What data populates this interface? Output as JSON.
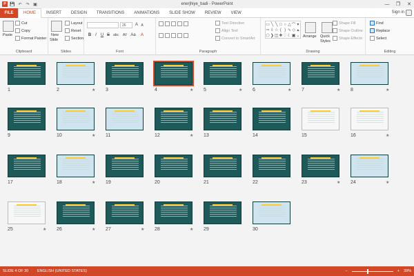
{
  "window": {
    "title": "enerjhiye_badi - PowerPoint",
    "signin": "Sign in",
    "minimize": "—",
    "restore": "❐",
    "close": "✕"
  },
  "qat": {
    "save": "💾",
    "undo": "↶",
    "redo": "↷",
    "start": "▣"
  },
  "tabs": [
    {
      "label": "FILE"
    },
    {
      "label": "HOME"
    },
    {
      "label": "INSERT"
    },
    {
      "label": "DESIGN"
    },
    {
      "label": "TRANSITIONS"
    },
    {
      "label": "ANIMATIONS"
    },
    {
      "label": "SLIDE SHOW"
    },
    {
      "label": "REVIEW"
    },
    {
      "label": "VIEW"
    }
  ],
  "ribbon": {
    "clipboard": {
      "label": "Clipboard",
      "paste": "Paste",
      "cut": "Cut",
      "copy": "Copy",
      "format_painter": "Format Painter"
    },
    "slides": {
      "label": "Slides",
      "new_slide": "New",
      "new_slide2": "Slide",
      "layout": "Layout",
      "reset": "Reset",
      "section": "Section"
    },
    "font": {
      "label": "Font",
      "size": "26",
      "bold": "B",
      "italic": "I",
      "underline": "U",
      "strike": "S",
      "shadow": "abc",
      "spacing": "AV",
      "case": "Aa",
      "color": "A",
      "grow": "A",
      "shrink": "A"
    },
    "paragraph": {
      "label": "Paragraph",
      "text_direction": "Text Direction",
      "align_text": "Align Text",
      "convert": "Convert to SmartArt"
    },
    "drawing": {
      "label": "Drawing",
      "arrange": "Arrange",
      "quick_styles": "Quick",
      "quick_styles2": "Styles",
      "shape_fill": "Shape Fill",
      "shape_outline": "Shape Outline",
      "shape_effects": "Shape Effects"
    },
    "editing": {
      "label": "Editing",
      "find": "Find",
      "replace": "Replace",
      "select": "Select"
    }
  },
  "slides": [
    {
      "n": "1",
      "star": false
    },
    {
      "n": "2",
      "star": true
    },
    {
      "n": "3",
      "star": false
    },
    {
      "n": "4",
      "star": true
    },
    {
      "n": "5",
      "star": true
    },
    {
      "n": "6",
      "star": true
    },
    {
      "n": "7",
      "star": true
    },
    {
      "n": "8",
      "star": true
    },
    {
      "n": "9",
      "star": false
    },
    {
      "n": "10",
      "star": true
    },
    {
      "n": "11",
      "star": false
    },
    {
      "n": "12",
      "star": true
    },
    {
      "n": "13",
      "star": false
    },
    {
      "n": "14",
      "star": false
    },
    {
      "n": "15",
      "star": false
    },
    {
      "n": "16",
      "star": true
    },
    {
      "n": "17",
      "star": false
    },
    {
      "n": "18",
      "star": true
    },
    {
      "n": "19",
      "star": false
    },
    {
      "n": "20",
      "star": false
    },
    {
      "n": "21",
      "star": false
    },
    {
      "n": "22",
      "star": false
    },
    {
      "n": "23",
      "star": true
    },
    {
      "n": "24",
      "star": true
    },
    {
      "n": "25",
      "star": true
    },
    {
      "n": "26",
      "star": true
    },
    {
      "n": "27",
      "star": true
    },
    {
      "n": "28",
      "star": true
    },
    {
      "n": "29",
      "star": false
    },
    {
      "n": "30",
      "star": false
    }
  ],
  "status": {
    "slide_info": "SLIDE 4 OF 30",
    "language": "ENGLISH (UNITED STATES)",
    "zoom": "39%",
    "zoom_minus": "−",
    "zoom_plus": "+"
  },
  "colors": {
    "accent": "#d24726",
    "slide_bg": "#1f5a5a"
  }
}
